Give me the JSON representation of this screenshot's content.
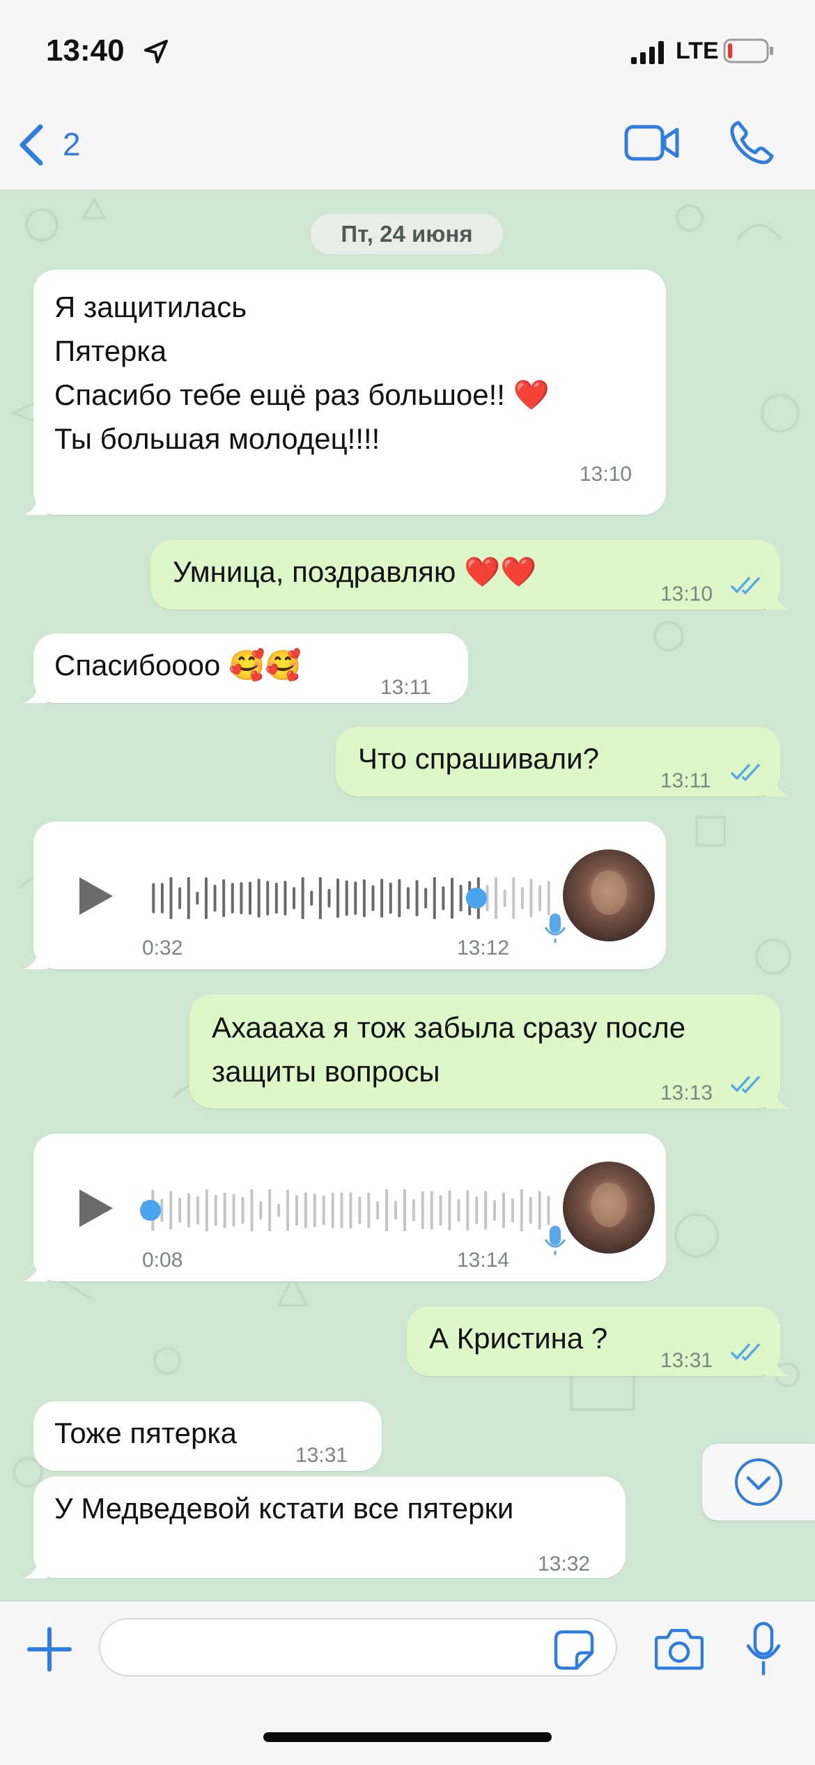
{
  "status_bar": {
    "time": "13:40",
    "network": "LTE",
    "battery_level": 0.12
  },
  "nav": {
    "back_count": "2"
  },
  "chat": {
    "date": "Пт, 24 июня",
    "messages": [
      {
        "dir": "in",
        "text": "Я защитилась\nПятерка\nСпасибо тебе ещё раз большое!! ❤️\nТы большая молодец!!!!",
        "time": "13:10"
      },
      {
        "dir": "out",
        "text": "Умница, поздравляю ❤️❤️",
        "time": "13:10"
      },
      {
        "dir": "in",
        "text": "Спасибоооо 🥰🥰",
        "time": "13:11"
      },
      {
        "dir": "out",
        "text": "Что спрашивали?",
        "time": "13:11"
      },
      {
        "dir": "in",
        "type": "voice",
        "duration": "0:32",
        "time": "13:12",
        "progress": 0.81
      },
      {
        "dir": "out",
        "text": "Ахаааха я тож забыла сразу после\nзащиты вопросы",
        "time": "13:13"
      },
      {
        "dir": "in",
        "type": "voice",
        "duration": "0:08",
        "time": "13:14",
        "progress": 0.0
      },
      {
        "dir": "out",
        "text": "А Кристина ?",
        "time": "13:31"
      },
      {
        "dir": "in",
        "text": "Тоже пятерка",
        "time": "13:31"
      },
      {
        "dir": "in",
        "text": "У Медведевой кстати все пятерки",
        "time": "13:32"
      }
    ]
  },
  "input": {
    "placeholder": "",
    "value": ""
  },
  "colors": {
    "accent": "#2f7de1",
    "bubble_in": "#ffffff",
    "bubble_out": "#ddf7c8",
    "chat_bg": "#cfe6d3",
    "read_ticks": "#5aa7e8",
    "voice_dot": "#4aa3ee"
  },
  "icons": [
    "location-arrow-icon",
    "signal-icon",
    "battery-icon",
    "back-chevron-icon",
    "video-call-icon",
    "phone-call-icon",
    "play-icon",
    "waveform-icon",
    "mic-badge-icon",
    "scroll-down-icon",
    "plus-icon",
    "sticker-icon",
    "camera-icon",
    "mic-icon"
  ]
}
